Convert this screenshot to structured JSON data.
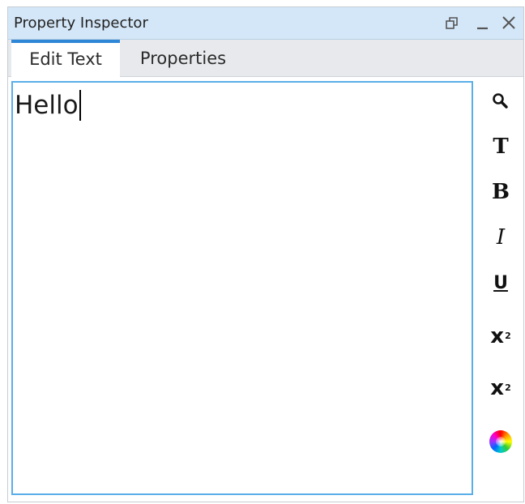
{
  "window": {
    "title": "Property Inspector",
    "buttons": {
      "restore": "restore-icon",
      "minimize": "minimize-icon",
      "close": "close-icon"
    }
  },
  "tabs": [
    {
      "label": "Edit Text",
      "active": true
    },
    {
      "label": "Properties",
      "active": false
    }
  ],
  "editor": {
    "text": "Hello"
  },
  "toolbar": {
    "search": {
      "icon": "magnifier-icon"
    },
    "font": {
      "label": "T"
    },
    "bold": {
      "label": "B"
    },
    "italic": {
      "label": "I"
    },
    "underline": {
      "label": "U"
    },
    "superscript": {
      "base": "x",
      "mark": "2"
    },
    "subscript": {
      "base": "x",
      "mark": "2"
    },
    "color": {
      "icon": "color-wheel-icon"
    }
  },
  "colors": {
    "titlebar": "#d4e7f8",
    "tab_accent": "#2e86d6",
    "editor_border": "#5aaee8"
  }
}
